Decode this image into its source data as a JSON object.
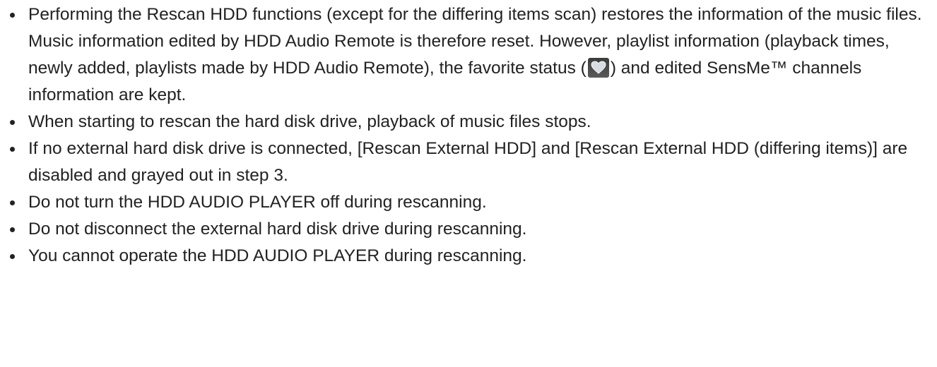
{
  "notes": [
    {
      "before_icon": "Performing the Rescan HDD functions (except for the differing items scan) restores the information of the music files. Music information edited by HDD Audio Remote is therefore reset. However, playlist information (playback times, newly added, playlists made by HDD Audio Remote), the favorite status (",
      "icon": "heart-icon",
      "after_icon": ") and edited SensMe™ channels information are kept."
    },
    {
      "text": "When starting to rescan the hard disk drive, playback of music files stops."
    },
    {
      "text": "If no external hard disk drive is connected, [Rescan External HDD] and [Rescan External HDD (differing items)] are disabled and grayed out in step 3."
    },
    {
      "text": "Do not turn the HDD AUDIO PLAYER off during rescanning."
    },
    {
      "text": "Do not disconnect the external hard disk drive during rescanning."
    },
    {
      "text": "You cannot operate the HDD AUDIO PLAYER during rescanning."
    }
  ]
}
